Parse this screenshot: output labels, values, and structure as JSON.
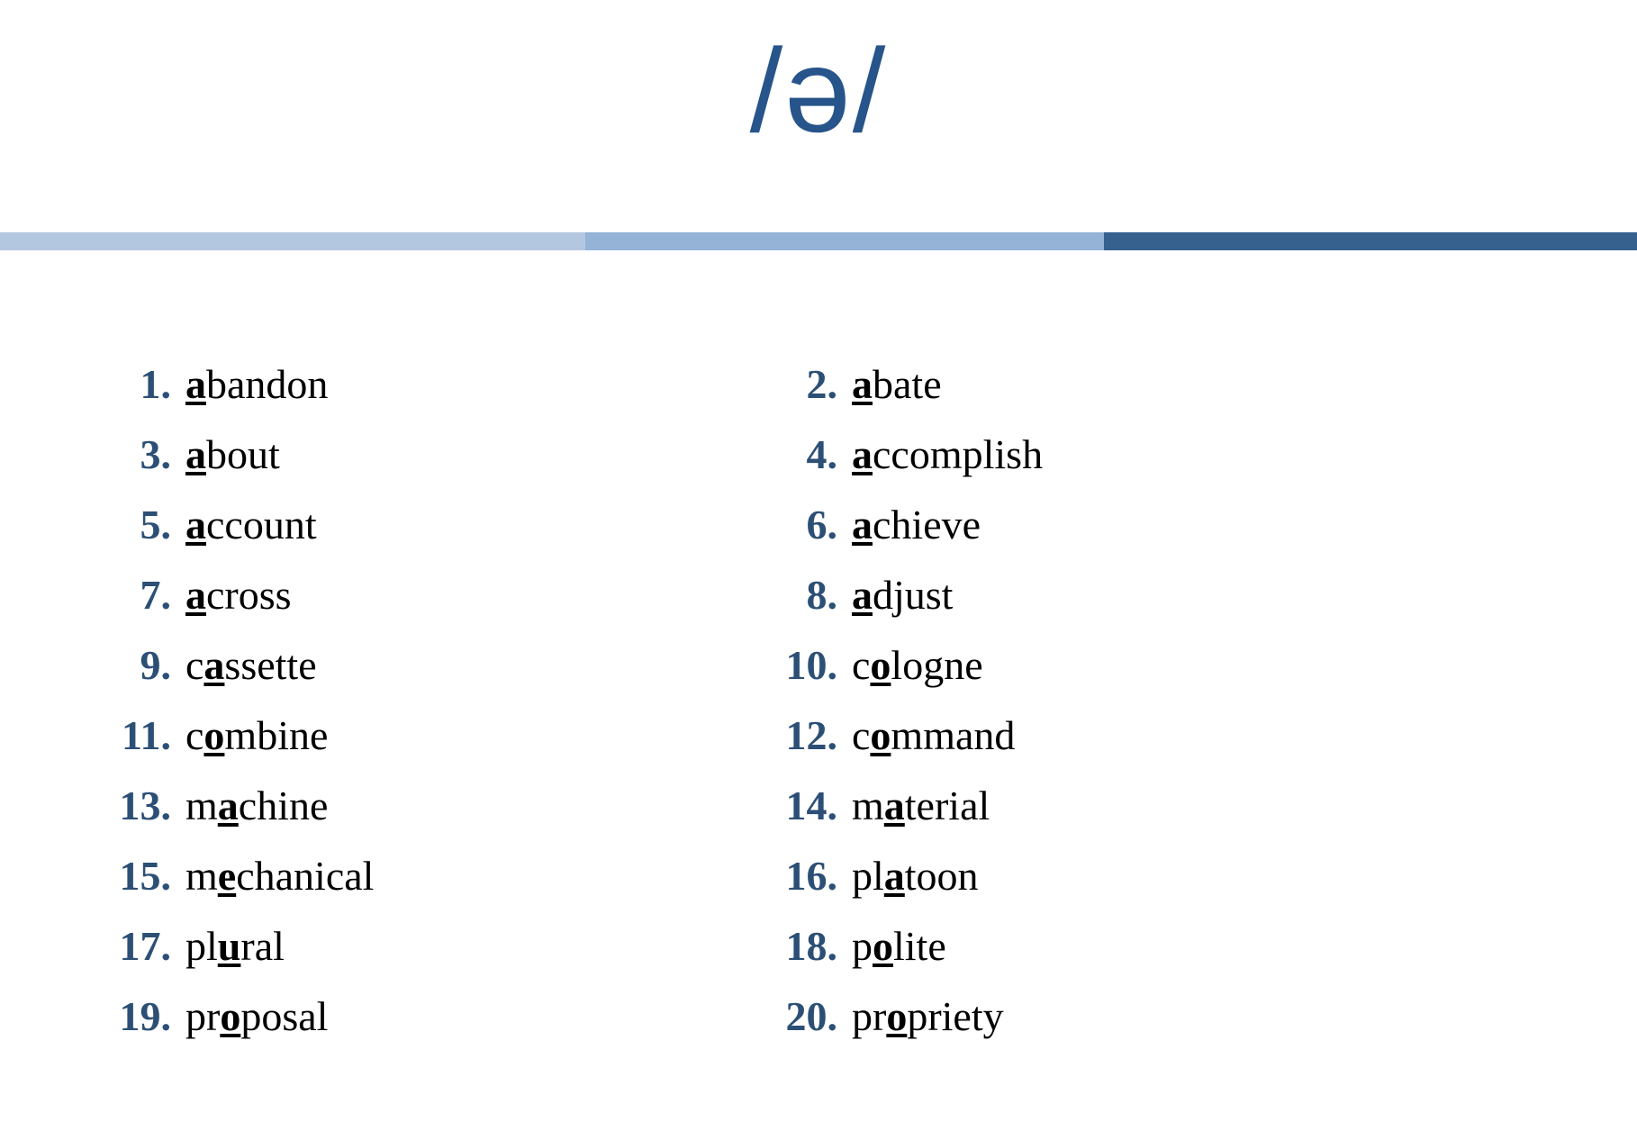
{
  "slide": {
    "title": "/ə/",
    "title_color": "#27548a",
    "background_color": "#ffffff",
    "number_color": "#2c4f75",
    "word_color": "#000000"
  },
  "divider": {
    "segments": [
      {
        "name": "light",
        "color": "#b4c7e0"
      },
      {
        "name": "medium",
        "color": "#94b3d7"
      },
      {
        "name": "dark",
        "color": "#36618e"
      }
    ]
  },
  "columns": {
    "left": [
      {
        "number": "1.",
        "pre": "",
        "stress": "a",
        "post": "bandon"
      },
      {
        "number": "3.",
        "pre": "",
        "stress": "a",
        "post": "bout"
      },
      {
        "number": "5.",
        "pre": "",
        "stress": "a",
        "post": "ccount"
      },
      {
        "number": "7.",
        "pre": "",
        "stress": "a",
        "post": "cross"
      },
      {
        "number": "9.",
        "pre": "c",
        "stress": "a",
        "post": "ssette"
      },
      {
        "number": "11.",
        "pre": "c",
        "stress": "o",
        "post": "mbine"
      },
      {
        "number": "13.",
        "pre": "m",
        "stress": "a",
        "post": "chine"
      },
      {
        "number": "15.",
        "pre": "m",
        "stress": "e",
        "post": "chanical"
      },
      {
        "number": "17.",
        "pre": "pl",
        "stress": "u",
        "post": "ral"
      },
      {
        "number": "19.",
        "pre": "pr",
        "stress": "o",
        "post": "posal"
      }
    ],
    "right": [
      {
        "number": "2.",
        "pre": "",
        "stress": "a",
        "post": "bate"
      },
      {
        "number": "4.",
        "pre": "",
        "stress": "a",
        "post": "ccomplish"
      },
      {
        "number": "6.",
        "pre": "",
        "stress": "a",
        "post": "chieve"
      },
      {
        "number": "8.",
        "pre": "",
        "stress": "a",
        "post": "djust"
      },
      {
        "number": "10.",
        "pre": "c",
        "stress": "o",
        "post": "logne"
      },
      {
        "number": "12.",
        "pre": "c",
        "stress": "o",
        "post": "mmand"
      },
      {
        "number": "14.",
        "pre": "m",
        "stress": "a",
        "post": "terial"
      },
      {
        "number": "16.",
        "pre": "pl",
        "stress": "a",
        "post": "toon"
      },
      {
        "number": "18.",
        "pre": "p",
        "stress": "o",
        "post": "lite"
      },
      {
        "number": "20.",
        "pre": "pr",
        "stress": "o",
        "post": "priety"
      }
    ]
  }
}
